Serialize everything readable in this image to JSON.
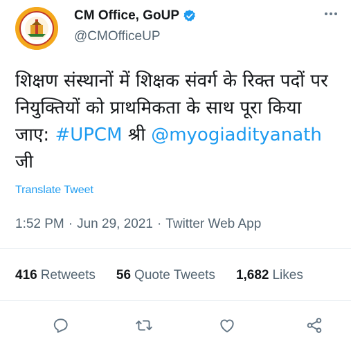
{
  "author": {
    "display_name": "CM Office, GoUP",
    "handle": "@CMOfficeUP",
    "verified": true,
    "avatar_icon": "up-government-emblem-icon"
  },
  "tweet": {
    "text_main": "शिक्षण संस्थानों में शिक्षक संवर्ग के रिक्त पदों पर नियुक्तियों को प्राथमिकता के साथ पूरा किया जाए: ",
    "hashtag": "#UPCM",
    "text_after_hashtag": " श्री ",
    "mention": "@myogiadityanath",
    "text_end": " जी",
    "translate_label": "Translate Tweet"
  },
  "meta": {
    "time": "1:52 PM",
    "separator1": "·",
    "date": "Jun 29, 2021",
    "separator2": "·",
    "source": "Twitter Web App"
  },
  "stats": {
    "retweets_count": "416",
    "retweets_label": "Retweets",
    "quotes_count": "56",
    "quotes_label": "Quote Tweets",
    "likes_count": "1,682",
    "likes_label": "Likes"
  },
  "actions": [
    "reply-icon",
    "retweet-icon",
    "like-icon",
    "share-icon"
  ],
  "colors": {
    "link": "#1d9bf0",
    "secondary_text": "#536471",
    "primary_text": "#14171a",
    "verified_badge": "#1d9bf0"
  }
}
